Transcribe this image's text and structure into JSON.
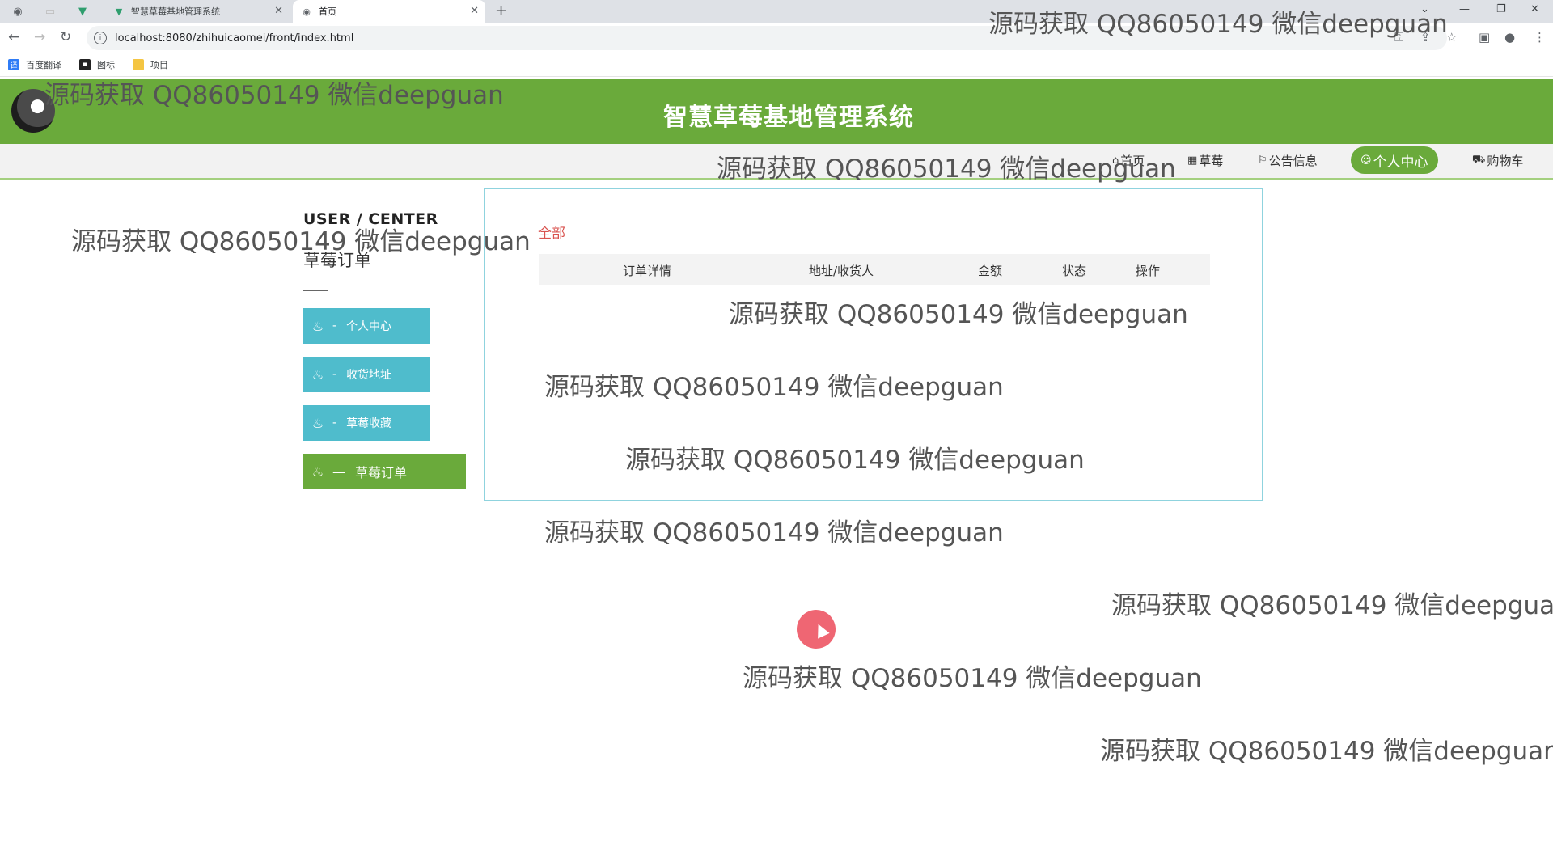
{
  "browser": {
    "tabs": [
      {
        "label": "智慧草莓基地管理系统",
        "favicon": "vue-logo-icon"
      },
      {
        "label": "首页",
        "favicon": "globe-icon"
      }
    ],
    "url": "localhost:8080/zhihuicaomei/front/index.html",
    "bookmarks": [
      {
        "label": "百度翻译",
        "icon": "translate-icon",
        "color": "#2f7cf6"
      },
      {
        "label": "图标",
        "icon": "image-icon",
        "color": "#222222"
      },
      {
        "label": "项目",
        "icon": "folder-icon",
        "color": "#f4c542"
      }
    ]
  },
  "header": {
    "title": "智慧草莓基地管理系统"
  },
  "menu": [
    {
      "label": "首页",
      "icon": "home-icon"
    },
    {
      "label": "草莓",
      "icon": "grid-icon"
    },
    {
      "label": "公告信息",
      "icon": "flag-icon"
    },
    {
      "label": "个人中心",
      "icon": "user-icon",
      "active": true
    },
    {
      "label": "购物车",
      "icon": "cart-icon"
    }
  ],
  "user_center": {
    "title": "USER / CENTER",
    "subtitle": "草莓订单",
    "side_items": [
      {
        "label": "个人中心",
        "active": false
      },
      {
        "label": "收货地址",
        "active": false
      },
      {
        "label": "草莓收藏",
        "active": false
      },
      {
        "label": "草莓订单",
        "active": true
      }
    ]
  },
  "orders": {
    "filter": "全部",
    "columns": [
      "订单详情",
      "地址/收货人",
      "金额",
      "状态",
      "操作"
    ],
    "rows": []
  },
  "watermark": "源码获取 QQ86050149 微信deepguan",
  "colors": {
    "header_green": "#6aaa3b",
    "side_teal": "#4fbccc",
    "box_border": "#8fd3de",
    "filter_red": "#d9534f"
  }
}
